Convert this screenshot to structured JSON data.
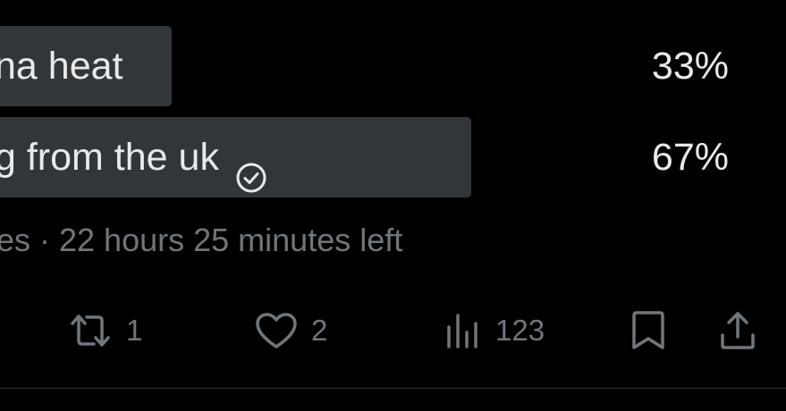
{
  "poll": {
    "options": [
      {
        "label": "na heat",
        "percent": "33%",
        "share": 0.33,
        "winner": false
      },
      {
        "label": "g from the uk",
        "percent": "67%",
        "share": 0.67,
        "winner": true
      }
    ],
    "meta": "es · 22 hours 25 minutes left"
  },
  "actions": {
    "retweets": "1",
    "likes": "2",
    "views": "123"
  },
  "colors": {
    "background": "#000000",
    "bar": "#333639",
    "text": "#e7e9ea",
    "muted": "#71767b",
    "divider": "#2f3336"
  },
  "icons": {
    "winner": "check-circle-icon",
    "retweet": "retweet-icon",
    "like": "heart-icon",
    "views": "views-icon",
    "bookmark": "bookmark-icon",
    "share": "share-icon"
  }
}
